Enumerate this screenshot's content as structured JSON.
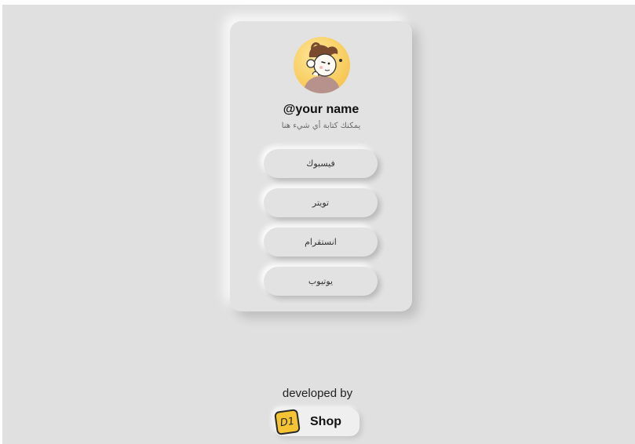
{
  "profile": {
    "handle": "@your name",
    "bio": "يمكنك كتابة أي شيء هنا"
  },
  "links": [
    {
      "label": "فيسبوك"
    },
    {
      "label": "تويتر"
    },
    {
      "label": "انستقرام"
    },
    {
      "label": "يوتيوب"
    }
  ],
  "footer": {
    "developed_by": "developed by",
    "logo_mark": "D1",
    "shop_label": "Shop"
  },
  "colors": {
    "background": "#e0e0e0",
    "card": "#e2e2e2",
    "avatar_bg": "#f9cf64",
    "logo_yellow": "#f5c435"
  }
}
